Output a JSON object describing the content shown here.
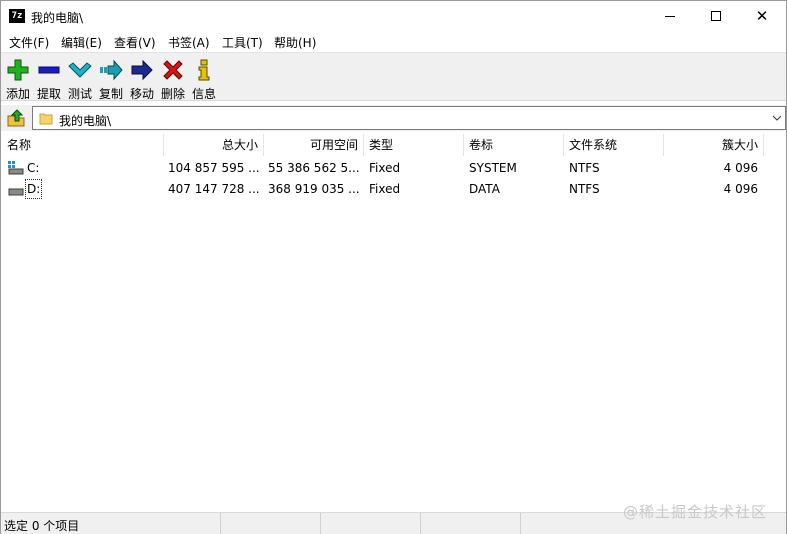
{
  "window": {
    "app_icon_text": "7z",
    "title": "我的电脑\\"
  },
  "menu": [
    {
      "label": "文件(F)"
    },
    {
      "label": "编辑(E)"
    },
    {
      "label": "查看(V)"
    },
    {
      "label": "书签(A)"
    },
    {
      "label": "工具(T)"
    },
    {
      "label": "帮助(H)"
    }
  ],
  "toolbar": [
    {
      "label": "添加",
      "icon": "add-icon",
      "color": "#1fb11f"
    },
    {
      "label": "提取",
      "icon": "extract-icon",
      "color": "#1a1acd"
    },
    {
      "label": "测试",
      "icon": "test-icon",
      "color": "#19b3c9"
    },
    {
      "label": "复制",
      "icon": "copy-icon",
      "color": "#19a0b0"
    },
    {
      "label": "移动",
      "icon": "move-icon",
      "color": "#1a2a8f"
    },
    {
      "label": "删除",
      "icon": "delete-icon",
      "color": "#d21515"
    },
    {
      "label": "信息",
      "icon": "info-icon",
      "color": "#e3c400"
    }
  ],
  "address": {
    "path": "我的电脑\\"
  },
  "columns": [
    {
      "label": "名称"
    },
    {
      "label": "总大小"
    },
    {
      "label": "可用空间"
    },
    {
      "label": "类型"
    },
    {
      "label": "卷标"
    },
    {
      "label": "文件系统"
    },
    {
      "label": "簇大小"
    }
  ],
  "rows": [
    {
      "name": "C:",
      "total": "104 857 595 ...",
      "free": "55 386 562 5...",
      "type": "Fixed",
      "label": "SYSTEM",
      "fs": "NTFS",
      "cluster": "4 096"
    },
    {
      "name": "D:",
      "total": "407 147 728 ...",
      "free": "368 919 035 ...",
      "type": "Fixed",
      "label": "DATA",
      "fs": "NTFS",
      "cluster": "4 096"
    }
  ],
  "status": {
    "text": "选定 0 个项目"
  },
  "watermark": "@稀土掘金技术社区"
}
